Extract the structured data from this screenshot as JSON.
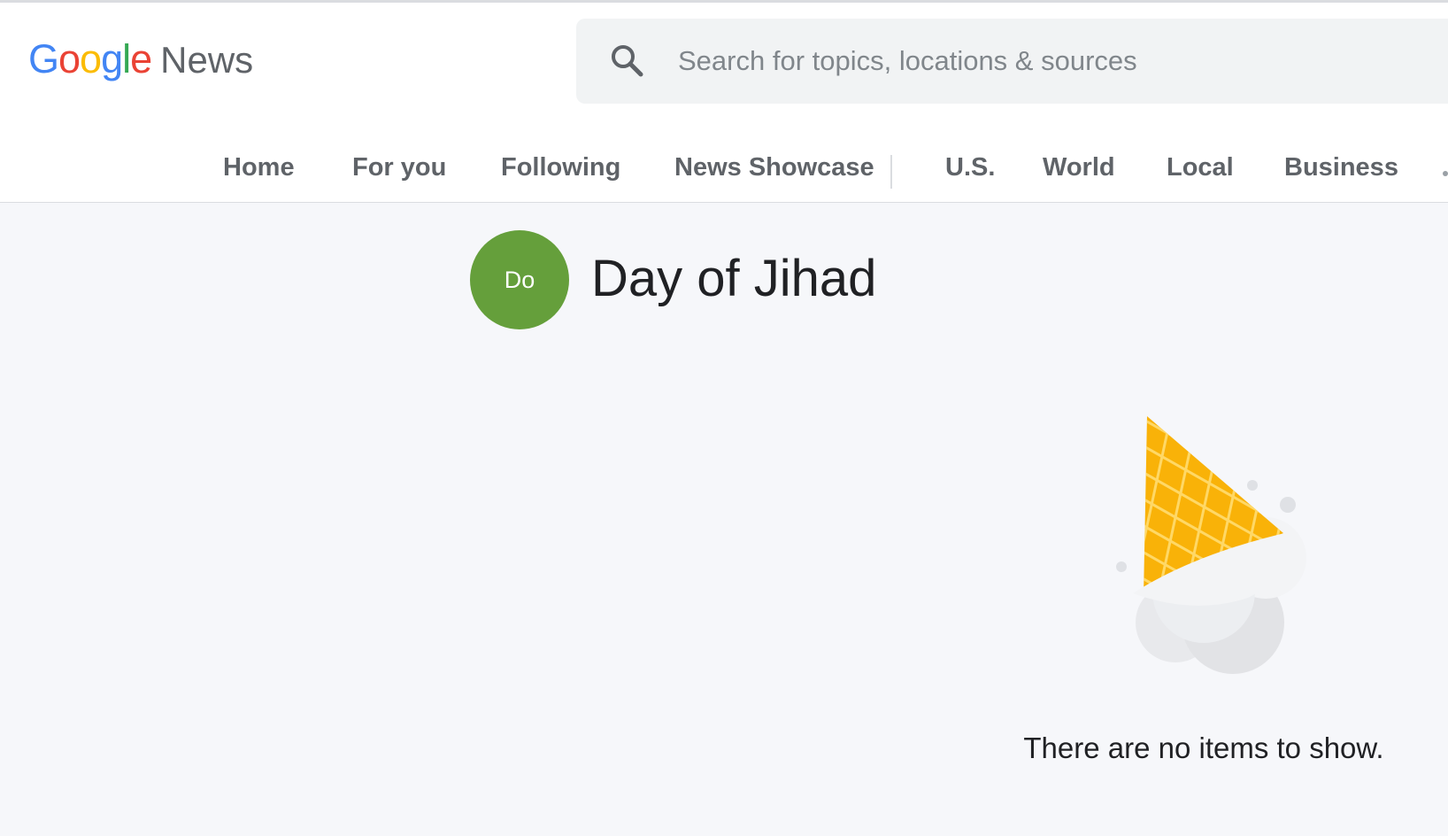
{
  "header": {
    "logo": {
      "google_letters": [
        {
          "char": "G",
          "color": "#4285f4"
        },
        {
          "char": "o",
          "color": "#ea4335"
        },
        {
          "char": "o",
          "color": "#fbbc05"
        },
        {
          "char": "g",
          "color": "#4285f4"
        },
        {
          "char": "l",
          "color": "#34a853"
        },
        {
          "char": "e",
          "color": "#ea4335"
        }
      ],
      "product": "News"
    },
    "search": {
      "icon": "search-icon",
      "placeholder": "Search for topics, locations & sources",
      "value": ""
    },
    "nav": {
      "primary": [
        "Home",
        "For you",
        "Following",
        "News Showcase"
      ],
      "sections": [
        "U.S.",
        "World",
        "Local",
        "Business"
      ]
    }
  },
  "topic": {
    "avatar_initials": "Do",
    "avatar_color": "#659f3b",
    "title": "Day of Jihad"
  },
  "empty_state": {
    "illustration": "dropped-ice-cream-cone",
    "message": "There are no items to show."
  },
  "colors": {
    "page_background": "#f6f7fa",
    "header_background": "#ffffff",
    "nav_text": "#5f6368",
    "cone": "#f9b208"
  }
}
